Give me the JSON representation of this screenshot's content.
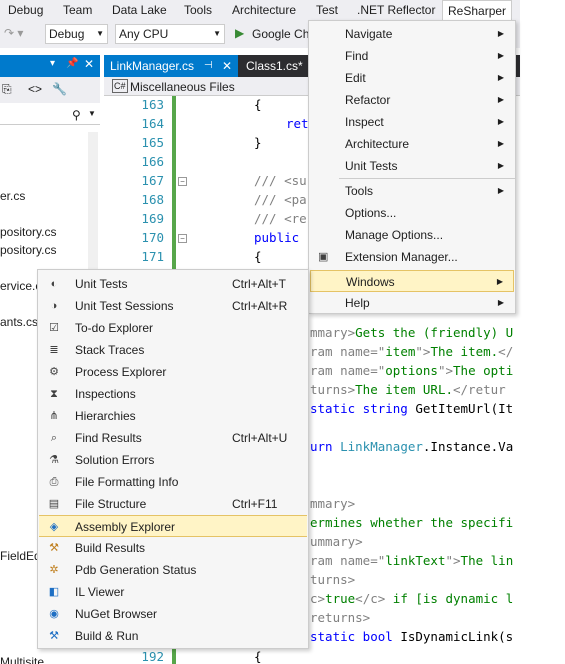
{
  "menubar": {
    "items": [
      "Debug",
      "Team",
      "Data Lake",
      "Tools",
      "Architecture",
      "Test",
      ".NET Reflector",
      "ReSharper"
    ]
  },
  "toolbar": {
    "config": "Debug",
    "platform": "Any CPU",
    "run": "Google Ch"
  },
  "tabs": {
    "tab1": "LinkManager.cs",
    "tab2": "Class1.cs*",
    "misc": "Miscellaneous Files"
  },
  "left_panel": {
    "items": [
      "er.cs",
      "pository.cs",
      "pository.cs",
      "ervice.cs",
      "ants.cs",
      "FieldEd",
      "Multisite"
    ]
  },
  "editor": {
    "line_numbers": [
      "163",
      "164",
      "165",
      "166",
      "167",
      "168",
      "169",
      "170",
      "171",
      "192"
    ]
  },
  "resharper_menu": {
    "items": [
      {
        "label": "Navigate",
        "sub": true
      },
      {
        "label": "Find",
        "sub": true
      },
      {
        "label": "Edit",
        "sub": true
      },
      {
        "label": "Refactor",
        "sub": true
      },
      {
        "label": "Inspect",
        "sub": true
      },
      {
        "label": "Architecture",
        "sub": true
      },
      {
        "label": "Unit Tests",
        "sub": true
      },
      {
        "label": "Tools",
        "sub": true
      },
      {
        "label": "Options...",
        "sub": false
      },
      {
        "label": "Manage Options...",
        "sub": false
      },
      {
        "label": "Extension Manager...",
        "sub": false
      },
      {
        "label": "Windows",
        "sub": true
      },
      {
        "label": "Help",
        "sub": true
      }
    ]
  },
  "windows_menu": {
    "items": [
      {
        "label": "Unit Tests",
        "shortcut": "Ctrl+Alt+T",
        "icon": "unit-tests-icon"
      },
      {
        "label": "Unit Test Sessions",
        "shortcut": "Ctrl+Alt+R",
        "icon": "unit-test-sessions-icon"
      },
      {
        "label": "To-do Explorer",
        "shortcut": "",
        "icon": "todo-icon"
      },
      {
        "label": "Stack Traces",
        "shortcut": "",
        "icon": "stack-traces-icon"
      },
      {
        "label": "Process Explorer",
        "shortcut": "",
        "icon": "process-icon"
      },
      {
        "label": "Inspections",
        "shortcut": "",
        "icon": "inspections-icon"
      },
      {
        "label": "Hierarchies",
        "shortcut": "",
        "icon": "hierarchies-icon"
      },
      {
        "label": "Find Results",
        "shortcut": "Ctrl+Alt+U",
        "icon": "find-results-icon"
      },
      {
        "label": "Solution Errors",
        "shortcut": "",
        "icon": "solution-errors-icon"
      },
      {
        "label": "File Formatting Info",
        "shortcut": "",
        "icon": "formatting-icon"
      },
      {
        "label": "File Structure",
        "shortcut": "Ctrl+F11",
        "icon": "file-structure-icon"
      },
      {
        "label": "Assembly Explorer",
        "shortcut": "",
        "icon": "assembly-icon"
      },
      {
        "label": "Build Results",
        "shortcut": "",
        "icon": "build-results-icon"
      },
      {
        "label": "Pdb Generation Status",
        "shortcut": "",
        "icon": "pdb-icon"
      },
      {
        "label": "IL Viewer",
        "shortcut": "",
        "icon": "il-viewer-icon"
      },
      {
        "label": "NuGet Browser",
        "shortcut": "",
        "icon": "nuget-icon"
      },
      {
        "label": "Build & Run",
        "shortcut": "",
        "icon": "build-run-icon"
      }
    ]
  }
}
